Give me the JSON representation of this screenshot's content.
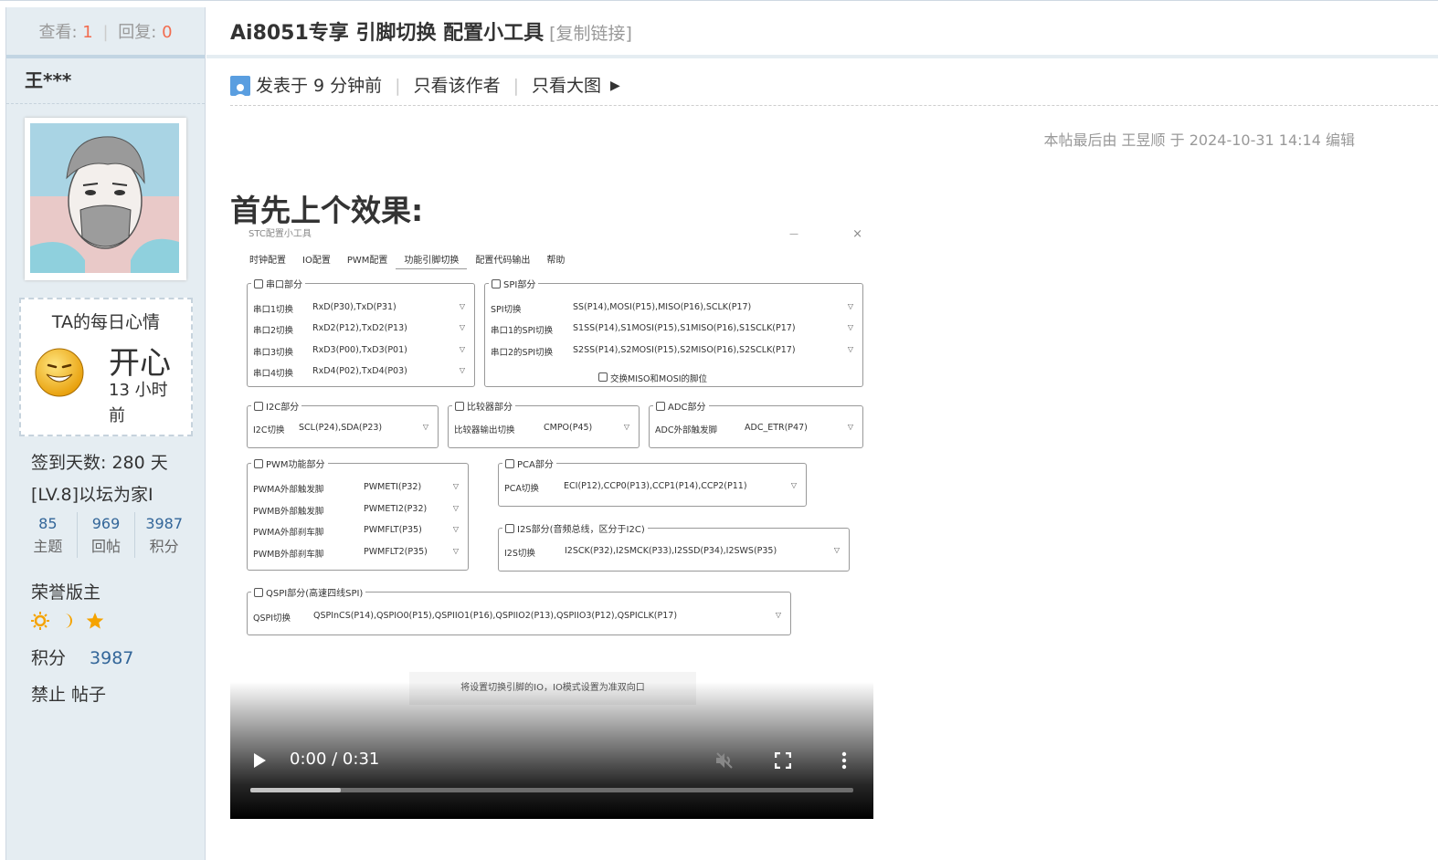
{
  "sidebar": {
    "views_label": "查看:",
    "views_value": "1",
    "replies_label": "回复:",
    "replies_value": "0",
    "username": "王***",
    "mood": {
      "title": "TA的每日心情",
      "word": "开心",
      "time": "13 小时前"
    },
    "signin": "签到天数: 280 天",
    "level": "[LV.8]以坛为家I",
    "counts": [
      {
        "value": "85",
        "label": "主题"
      },
      {
        "value": "969",
        "label": "回帖"
      },
      {
        "value": "3987",
        "label": "积分"
      }
    ],
    "group": "荣誉版主",
    "medal_icons": [
      "sun-icon",
      "moon-icon",
      "star-icon"
    ],
    "score_label": "积分",
    "score_value": "3987",
    "actions": "禁止 帖子"
  },
  "post": {
    "title": "Ai8051专享 引脚切换 配置小工具",
    "copy_link": "[复制链接]",
    "posted": "发表于 9 分钟前",
    "only_author": "只看该作者",
    "only_big": "只看大图",
    "edited": "本帖最后由 王昱顺 于 2024-10-31 14:14 编辑",
    "heading": "首先上个效果:"
  },
  "app": {
    "window_title": "STC配置小工具",
    "tabs": [
      "时钟配置",
      "IO配置",
      "PWM配置",
      "功能引脚切换",
      "配置代码输出",
      "帮助"
    ],
    "active_tab": 3,
    "groups": {
      "uart": {
        "title": "串口部分",
        "rows": [
          {
            "label": "串口1切换",
            "value": "RxD(P30),TxD(P31)"
          },
          {
            "label": "串口2切换",
            "value": "RxD2(P12),TxD2(P13)"
          },
          {
            "label": "串口3切换",
            "value": "RxD3(P00),TxD3(P01)"
          },
          {
            "label": "串口4切换",
            "value": "RxD4(P02),TxD4(P03)"
          }
        ]
      },
      "spi": {
        "title": "SPI部分",
        "rows": [
          {
            "label": "SPI切换",
            "value": "SS(P14),MOSI(P15),MISO(P16),SCLK(P17)"
          },
          {
            "label": "串口1的SPI切换",
            "value": "S1SS(P14),S1MOSI(P15),S1MISO(P16),S1SCLK(P17)"
          },
          {
            "label": "串口2的SPI切换",
            "value": "S2SS(P14),S2MOSI(P15),S2MISO(P16),S2SCLK(P17)"
          }
        ],
        "swap": "交换MISO和MOSI的脚位"
      },
      "i2c": {
        "title": "I2C部分",
        "label": "I2C切换",
        "value": "SCL(P24),SDA(P23)"
      },
      "cmp": {
        "title": "比较器部分",
        "label": "比较器输出切换",
        "value": "CMPO(P45)"
      },
      "adc": {
        "title": "ADC部分",
        "label": "ADC外部触发脚",
        "value": "ADC_ETR(P47)"
      },
      "pwm": {
        "title": "PWM功能部分",
        "rows": [
          {
            "label": "PWMA外部触发脚",
            "value": "PWMETI(P32)"
          },
          {
            "label": "PWMB外部触发脚",
            "value": "PWMETI2(P32)"
          },
          {
            "label": "PWMA外部刹车脚",
            "value": "PWMFLT(P35)"
          },
          {
            "label": "PWMB外部刹车脚",
            "value": "PWMFLT2(P35)"
          }
        ]
      },
      "pca": {
        "title": "PCA部分",
        "label": "PCA切换",
        "value": "ECI(P12),CCP0(P13),CCP1(P14),CCP2(P11)"
      },
      "i2s": {
        "title": "I2S部分(音频总线，区分于I2C)",
        "label": "I2S切换",
        "value": "I2SCK(P32),I2SMCK(P33),I2SSD(P34),I2SWS(P35)"
      },
      "qspi": {
        "title": "QSPI部分(高速四线SPI)",
        "label": "QSPI切换",
        "value": "QSPInCS(P14),QSPIO0(P15),QSPIIO1(P16),QSPIIO2(P13),QSPIIO3(P12),QSPICLK(P17)"
      }
    },
    "hint": "将设置切换引脚的IO，IO模式设置为准双向口"
  },
  "video": {
    "time": "0:00 / 0:31",
    "progress": 0,
    "buffered": 0.15
  }
}
